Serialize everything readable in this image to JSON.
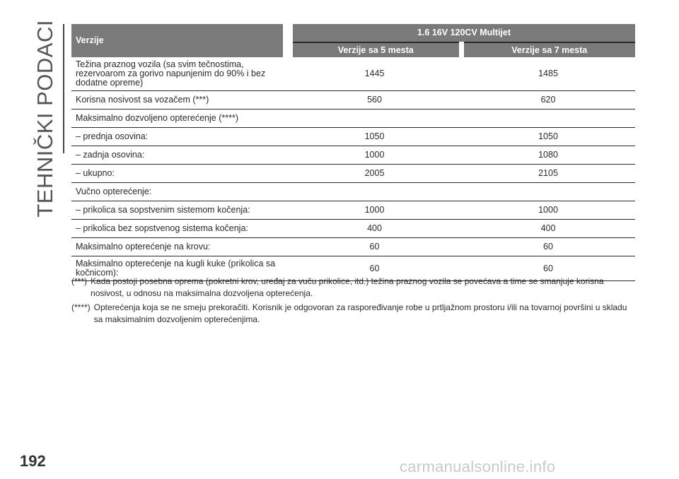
{
  "side": {
    "title": "TEHNIČKI PODACI"
  },
  "table": {
    "header": {
      "label": "Verzije",
      "engine": "1.6 16V 120CV Multijet",
      "sub": [
        "Verzije sa 5 mesta",
        "Verzije sa 7 mesta"
      ]
    },
    "rows": [
      {
        "label": "Težina praznog vozila (sa svim tečnostima, rezervoarom za gorivo napunjenim do 90% i bez dodatne opreme)",
        "v5": "1445",
        "v7": "1485"
      },
      {
        "label": "Korisna nosivost sa vozačem (***)",
        "v5": "560",
        "v7": "620"
      },
      {
        "label": "Maksimalno dozvoljeno opterećenje (****)",
        "v5": "",
        "v7": ""
      },
      {
        "label": "– prednja osovina:",
        "v5": "1050",
        "v7": "1050"
      },
      {
        "label": "– zadnja osovina:",
        "v5": "1000",
        "v7": "1080"
      },
      {
        "label": "– ukupno:",
        "v5": "2005",
        "v7": "2105"
      },
      {
        "label": "Vučno opterećenje:",
        "v5": "",
        "v7": ""
      },
      {
        "label": "– prikolica sa sopstvenim sistemom kočenja:",
        "v5": "1000",
        "v7": "1000"
      },
      {
        "label": "– prikolica bez sopstvenog sistema kočenja:",
        "v5": "400",
        "v7": "400"
      },
      {
        "label": "Maksimalno opterećenje na krovu:",
        "v5": "60",
        "v7": "60"
      },
      {
        "label": "Maksimalno opterećenje na kugli kuke (prikolica sa kočnicom):",
        "v5": "60",
        "v7": "60"
      }
    ]
  },
  "notes": [
    {
      "mark": "(***)",
      "text": "Kada postoji posebna oprema (pokretni krov, uređaj za vuču prikolice, itd.) težina praznog vozila se povećava a time se smanjuje korisna nosivost, u odnosu na maksimalna dozvoljena opterećenja."
    },
    {
      "mark": "(****)",
      "text": "Opterećenja koja se ne smeju prekoračiti. Korisnik je odgovoran za raspoređivanje robe u prtljažnom prostoru i/ili na tovarnoj površini u skladu sa maksimalnim dozvoljenim opterećenjima."
    }
  ],
  "footer": {
    "page_number": "192",
    "watermark": "carmanualsonline.info"
  },
  "colors": {
    "header_bg": "#7a7a7a",
    "text": "#2a2a2a",
    "watermark": "#c9c9c9"
  }
}
